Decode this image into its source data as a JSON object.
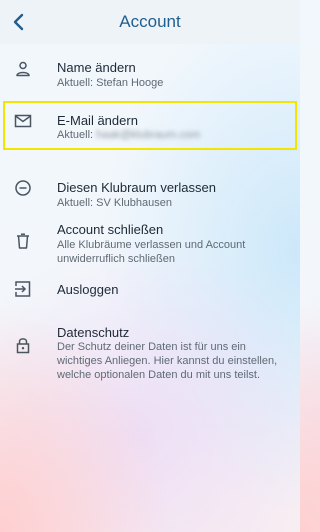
{
  "header": {
    "title": "Account",
    "back_icon": "chevron-left-icon"
  },
  "items": [
    {
      "label": "Name ändern",
      "sub": "Aktuell: Stefan Hooge",
      "icon": "person-icon"
    },
    {
      "label": "E-Mail ändern",
      "sub_prefix": "Aktuell:",
      "sub_value": "haak@klubraum.com",
      "icon": "mail-icon"
    },
    {
      "label": "Diesen Klubraum verlassen",
      "sub": "Aktuell: SV Klubhausen",
      "icon": "leave-circle-icon"
    },
    {
      "label": "Account schließen",
      "sub": "Alle Klubräume verlassen und Account unwiderruflich schließen",
      "icon": "trash-icon"
    },
    {
      "label": "Ausloggen",
      "icon": "logout-icon"
    },
    {
      "label": "Datenschutz",
      "sub": "Der Schutz deiner Daten ist für uns ein wichtiges Anliegen. Hier kannst du einstellen, welche optionalen Daten du mit uns teilst.",
      "icon": "lock-icon"
    }
  ],
  "colors": {
    "accent": "#1f5e8f",
    "highlight": "#f2e600"
  }
}
